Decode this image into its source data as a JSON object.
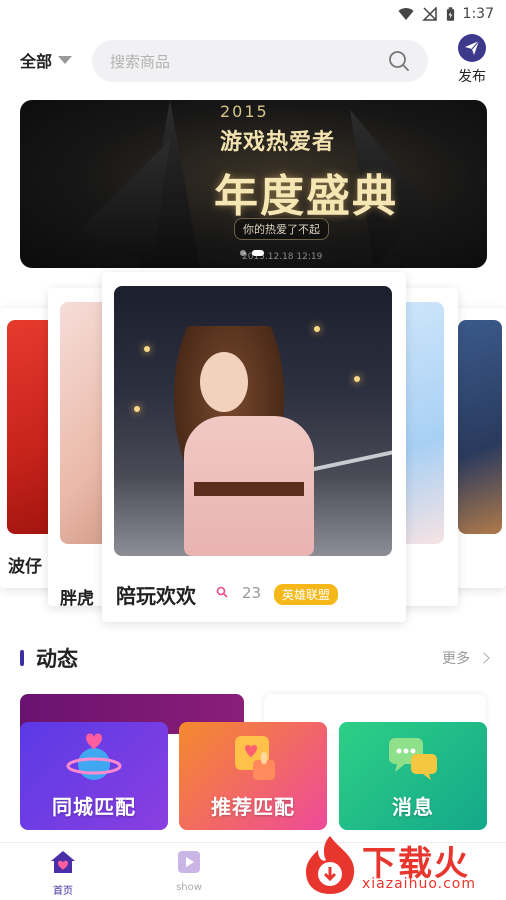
{
  "status_bar": {
    "time": "1:37"
  },
  "header": {
    "category": "全部",
    "search_placeholder": "搜索商品",
    "publish_label": "发布"
  },
  "banner": {
    "year": "2015",
    "title_top": "游戏热爱者",
    "title_main": "年度盛典",
    "subtitle": "你的热爱了不起",
    "date": "2015.12.18 12:19",
    "page_count": 2,
    "active_page": 1
  },
  "cards": {
    "front": {
      "name": "陪玩欢欢",
      "count": "23",
      "tag": "英雄联盟"
    },
    "left1": {
      "name": "胖虎"
    },
    "left2": {
      "name": "波仔"
    }
  },
  "section": {
    "title": "动态",
    "more": "更多"
  },
  "quick_actions": [
    {
      "label": "同城匹配"
    },
    {
      "label": "推荐匹配"
    },
    {
      "label": "消息"
    }
  ],
  "tabs": [
    {
      "label": "首页",
      "active": true
    },
    {
      "label": "show",
      "active": false
    }
  ],
  "watermark": {
    "text": "下载火",
    "url_text": "xiazaihuo.com"
  },
  "colors": {
    "accent": "#3d2fa0",
    "tag": "#f5b818",
    "watermark": "#e8352d"
  }
}
